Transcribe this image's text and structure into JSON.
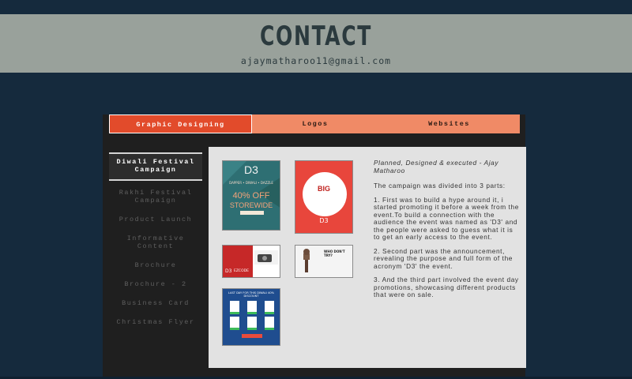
{
  "header": {
    "title": "CONTACT",
    "email": "ajaymatharoo11@gmail.com"
  },
  "tabs": [
    {
      "label": "Graphic Designing",
      "active": true
    },
    {
      "label": "Logos",
      "active": false
    },
    {
      "label": "Websites",
      "active": false
    }
  ],
  "sidebar": {
    "items": [
      {
        "label": "Diwali Festival Campaign",
        "active": true
      },
      {
        "label": "Rakhi Festival Campaign",
        "active": false
      },
      {
        "label": "Product Launch",
        "active": false
      },
      {
        "label": "Informative Content",
        "active": false
      },
      {
        "label": "Brochure",
        "active": false
      },
      {
        "label": "Brochure - 2",
        "active": false
      },
      {
        "label": "Business Card",
        "active": false
      },
      {
        "label": "Christmas Flyer",
        "active": false
      }
    ]
  },
  "thumbs": {
    "t1": {
      "brand": "D3",
      "tag": "DAPPER • DIWALI • DAZZLE",
      "offer": "40% OFF",
      "sub": "STOREWIDE"
    },
    "t2": {
      "headline": "BIG",
      "brand": "D3"
    },
    "t3": {
      "brand": "D3",
      "code": "EZCODE"
    },
    "t4": {
      "title": "WHO DON'T TRY?"
    },
    "t5": {
      "title": "LAST DAY FOR THIS DIWALI 40% DISCOUNT"
    }
  },
  "description": {
    "credit": "Planned, Designed & executed - Ajay Matharoo",
    "intro": "The campaign was divided into 3 parts:",
    "p1": "1. First was to build a hype around it, i started promoting it before a week from the event.To build a connection with the audience the event was named as 'D3' and the people were asked to guess what it is to get an early access to the event.",
    "p2": "2. Second part was the announcement, revealing the purpose and full form of the acronym 'D3' the event.",
    "p3": "3. And the third part involved the event day promotions, showcasing different products that were on sale."
  },
  "colors": {
    "background": "#152a3d",
    "header_bg": "#99a19b",
    "tab_active": "#e24b2b",
    "tab_inactive": "#f08a66",
    "panel": "#1f1f1f",
    "content": "#e2e2e2"
  }
}
